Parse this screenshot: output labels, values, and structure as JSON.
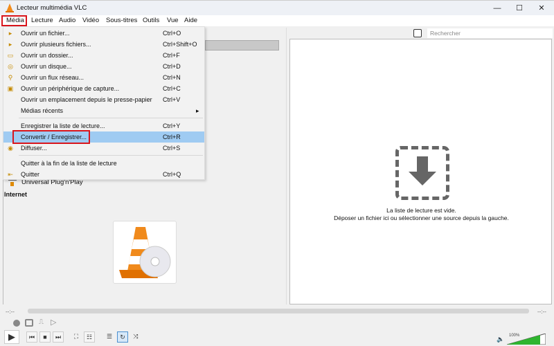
{
  "window": {
    "title": "Lecteur multimédia VLC",
    "minimize": "—",
    "maximize": "☐",
    "close": "✕"
  },
  "menubar": [
    "Média",
    "Lecture",
    "Audio",
    "Vidéo",
    "Sous-titres",
    "Outils",
    "Vue",
    "Aide"
  ],
  "media_menu": [
    {
      "label": "Ouvrir un fichier...",
      "shortcut": "Ctrl+O",
      "icon": "file-play-icon"
    },
    {
      "label": "Ouvrir plusieurs fichiers...",
      "shortcut": "Ctrl+Shift+O",
      "icon": "files-play-icon"
    },
    {
      "label": "Ouvrir un dossier...",
      "shortcut": "Ctrl+F",
      "icon": "folder-icon"
    },
    {
      "label": "Ouvrir un disque...",
      "shortcut": "Ctrl+D",
      "icon": "disc-icon"
    },
    {
      "label": "Ouvrir un flux réseau...",
      "shortcut": "Ctrl+N",
      "icon": "network-icon"
    },
    {
      "label": "Ouvrir un périphérique de capture...",
      "shortcut": "Ctrl+C",
      "icon": "capture-icon"
    },
    {
      "label": "Ouvrir un emplacement depuis le presse-papier",
      "shortcut": "Ctrl+V",
      "icon": ""
    },
    {
      "label": "Médias récents",
      "shortcut": "▸",
      "icon": ""
    },
    {
      "label": "Enregistrer la liste de lecture...",
      "shortcut": "Ctrl+Y",
      "icon": ""
    },
    {
      "label": "Convertir / Enregistrer...",
      "shortcut": "Ctrl+R",
      "icon": ""
    },
    {
      "label": "Diffuser...",
      "shortcut": "Ctrl+S",
      "icon": "stream-icon"
    },
    {
      "label": "Quitter à la fin de la liste de lecture",
      "shortcut": "",
      "icon": ""
    },
    {
      "label": "Quitter",
      "shortcut": "Ctrl+Q",
      "icon": "exit-icon"
    }
  ],
  "sidebar": {
    "upnp": "Universal Plug'n'Play",
    "internet": "Internet"
  },
  "search": {
    "placeholder": "Rechercher"
  },
  "playlist": {
    "empty_title": "La liste de lecture est vide.",
    "empty_hint": "Déposer un fichier ici ou sélectionner une source depuis la gauche."
  },
  "seek": {
    "elapsed": "--:--",
    "remaining": "--:--",
    "progress": 0
  },
  "volume": {
    "label": "100%",
    "level": 100
  },
  "colors": {
    "highlight": "#9fcbf2",
    "annotation": "#d9141b",
    "volume": "#2fb52f"
  }
}
